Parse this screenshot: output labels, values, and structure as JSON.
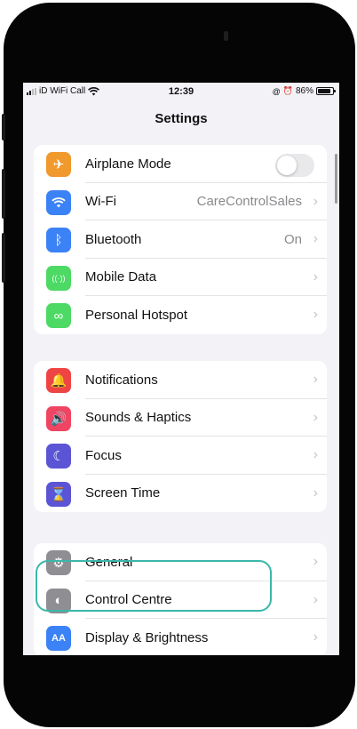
{
  "status_bar": {
    "carrier": "iD WiFi Call",
    "time": "12:39",
    "battery_percent": "86%",
    "icons": [
      "signal-bars",
      "wifi-icon",
      "location-icon",
      "alarm-icon",
      "battery-icon"
    ]
  },
  "nav": {
    "title": "Settings"
  },
  "groups": [
    {
      "items": [
        {
          "id": "airplane-mode",
          "label": "Airplane Mode",
          "icon": "airplane-icon",
          "glyph": "✈",
          "color": "#f0992c",
          "control": "toggle",
          "toggle_on": false
        },
        {
          "id": "wi-fi",
          "label": "Wi-Fi",
          "icon": "wifi-icon",
          "color": "#3b82f6",
          "value": "CareControlSales"
        },
        {
          "id": "bluetooth",
          "label": "Bluetooth",
          "icon": "bluetooth-icon",
          "glyph": "ᛒ",
          "color": "#3b82f6",
          "value": "On"
        },
        {
          "id": "mobile-data",
          "label": "Mobile Data",
          "icon": "antenna-icon",
          "glyph": "((·))",
          "color": "#4cd964"
        },
        {
          "id": "personal-hotspot",
          "label": "Personal Hotspot",
          "icon": "link-icon",
          "glyph": "∞",
          "color": "#4cd964"
        }
      ]
    },
    {
      "items": [
        {
          "id": "notifications",
          "label": "Notifications",
          "icon": "bell-icon",
          "glyph": "🔔",
          "color": "#ef4444"
        },
        {
          "id": "sounds-haptics",
          "label": "Sounds & Haptics",
          "icon": "speaker-icon",
          "glyph": "🔊",
          "color": "#ef4462"
        },
        {
          "id": "focus",
          "label": "Focus",
          "icon": "moon-icon",
          "glyph": "☾",
          "color": "#5b55d6"
        },
        {
          "id": "screen-time",
          "label": "Screen Time",
          "icon": "hourglass-icon",
          "glyph": "⌛",
          "color": "#5b55d6"
        }
      ]
    },
    {
      "items": [
        {
          "id": "general",
          "label": "General",
          "icon": "gear-icon",
          "glyph": "⚙",
          "color": "#8e8e93"
        },
        {
          "id": "control-centre",
          "label": "Control Centre",
          "icon": "toggles-icon",
          "glyph": "◐",
          "color": "#8e8e93"
        },
        {
          "id": "display-brightness",
          "label": "Display & Brightness",
          "icon": "text-size-icon",
          "glyph": "AA",
          "color": "#3b82f6"
        }
      ]
    }
  ],
  "chevron_glyph": "›",
  "highlight_color": "#3bb7a9"
}
